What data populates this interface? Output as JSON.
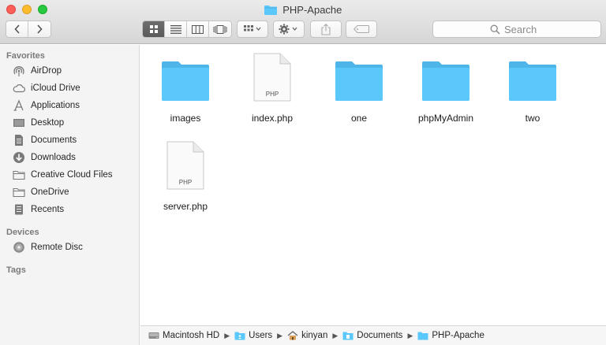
{
  "window": {
    "title": "PHP-Apache"
  },
  "toolbar": {
    "back_icon": "chevron-left-icon",
    "forward_icon": "chevron-right-icon",
    "view_modes": [
      "icon-view-icon",
      "list-view-icon",
      "column-view-icon",
      "cover-flow-icon"
    ],
    "search_placeholder": "Search"
  },
  "sidebar": {
    "sections": [
      {
        "header": "Favorites",
        "items": [
          {
            "label": "AirDrop",
            "icon": "airdrop-icon"
          },
          {
            "label": "iCloud Drive",
            "icon": "cloud-icon"
          },
          {
            "label": "Applications",
            "icon": "applications-icon"
          },
          {
            "label": "Desktop",
            "icon": "desktop-icon"
          },
          {
            "label": "Documents",
            "icon": "document-icon"
          },
          {
            "label": "Downloads",
            "icon": "download-icon"
          },
          {
            "label": "Creative Cloud Files",
            "icon": "folder-icon"
          },
          {
            "label": "OneDrive",
            "icon": "folder-icon"
          },
          {
            "label": "Recents",
            "icon": "recents-icon"
          }
        ]
      },
      {
        "header": "Devices",
        "items": [
          {
            "label": "Remote Disc",
            "icon": "disc-icon"
          }
        ]
      },
      {
        "header": "Tags",
        "items": []
      }
    ]
  },
  "files": [
    {
      "name": "images",
      "kind": "folder"
    },
    {
      "name": "index.php",
      "kind": "php-file",
      "badge": "PHP"
    },
    {
      "name": "one",
      "kind": "folder"
    },
    {
      "name": "phpMyAdmin",
      "kind": "folder"
    },
    {
      "name": "two",
      "kind": "folder"
    },
    {
      "name": "server.php",
      "kind": "php-file",
      "badge": "PHP"
    }
  ],
  "pathbar": [
    {
      "label": "Macintosh HD",
      "icon": "hard-drive-icon"
    },
    {
      "label": "Users",
      "icon": "folder-icon"
    },
    {
      "label": "kinyan",
      "icon": "home-icon"
    },
    {
      "label": "Documents",
      "icon": "documents-folder-icon"
    },
    {
      "label": "PHP-Apache",
      "icon": "folder-icon"
    }
  ],
  "colors": {
    "folder_blue": "#5ac8fa",
    "folder_tab": "#4db5e8",
    "active_seg": "#5f5f5f"
  }
}
